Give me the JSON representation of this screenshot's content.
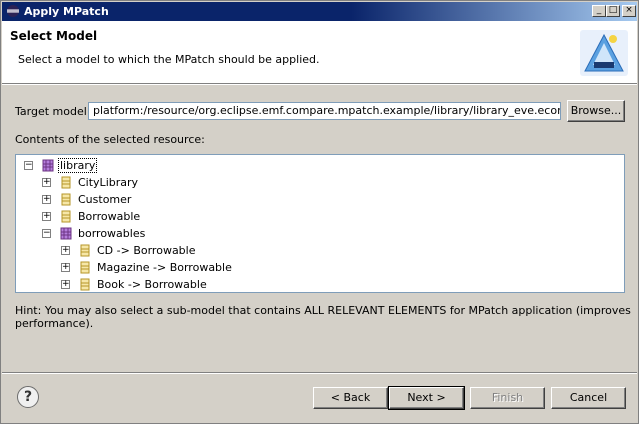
{
  "window": {
    "title": "Apply MPatch",
    "controls": [
      "_",
      "□",
      "×"
    ]
  },
  "header": {
    "title": "Select Model",
    "description": "Select a model to which the MPatch should be applied."
  },
  "target": {
    "label": "Target model:",
    "value": "platform:/resource/org.eclipse.emf.compare.mpatch.example/library/library_eve.ecore",
    "browse_label": "Browse..."
  },
  "contents_label": "Contents of the selected resource:",
  "tree": [
    {
      "label": "library",
      "icon": "package-icon",
      "expanded": true,
      "selected": true
    },
    {
      "label": "CityLibrary",
      "icon": "class-icon",
      "expanded": false
    },
    {
      "label": "Customer",
      "icon": "class-icon",
      "expanded": false
    },
    {
      "label": "Borrowable",
      "icon": "class-icon",
      "expanded": false
    },
    {
      "label": "borrowables",
      "icon": "package-icon",
      "expanded": true
    },
    {
      "label": "CD -> Borrowable",
      "icon": "class-icon",
      "expanded": false
    },
    {
      "label": "Magazine -> Borrowable",
      "icon": "class-icon",
      "expanded": false
    },
    {
      "label": "Book -> Borrowable",
      "icon": "class-icon",
      "expanded": false
    }
  ],
  "hint": "Hint: You may also select a sub-model that contains ALL RELEVANT ELEMENTS for MPatch application (improves performance).",
  "buttons": {
    "help": "?",
    "back": "< Back",
    "next": "Next >",
    "finish": "Finish",
    "cancel": "Cancel"
  },
  "colors": {
    "titlebar": "#0a246a",
    "package_icon": "#8e44ad",
    "class_icon": "#c8a640"
  }
}
